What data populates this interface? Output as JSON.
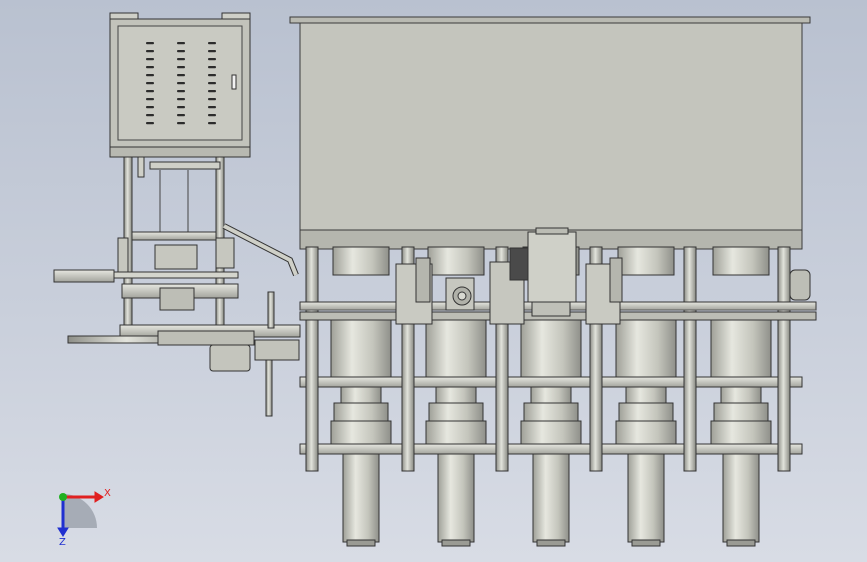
{
  "viewport": {
    "background_top": "#b9c1d0",
    "background_bottom": "#d8dce5"
  },
  "triad": {
    "x_label": "X",
    "z_label": "Z",
    "x_color": "#e02020",
    "z_color": "#2030d0",
    "y_color": "#20b020"
  },
  "materials": {
    "panel": "#c4c5bd",
    "steel": "#c9cac2",
    "outline": "#3a3a3a"
  },
  "model": {
    "description_icon": "cad-assembly-icon",
    "cylinder_count": 5
  }
}
